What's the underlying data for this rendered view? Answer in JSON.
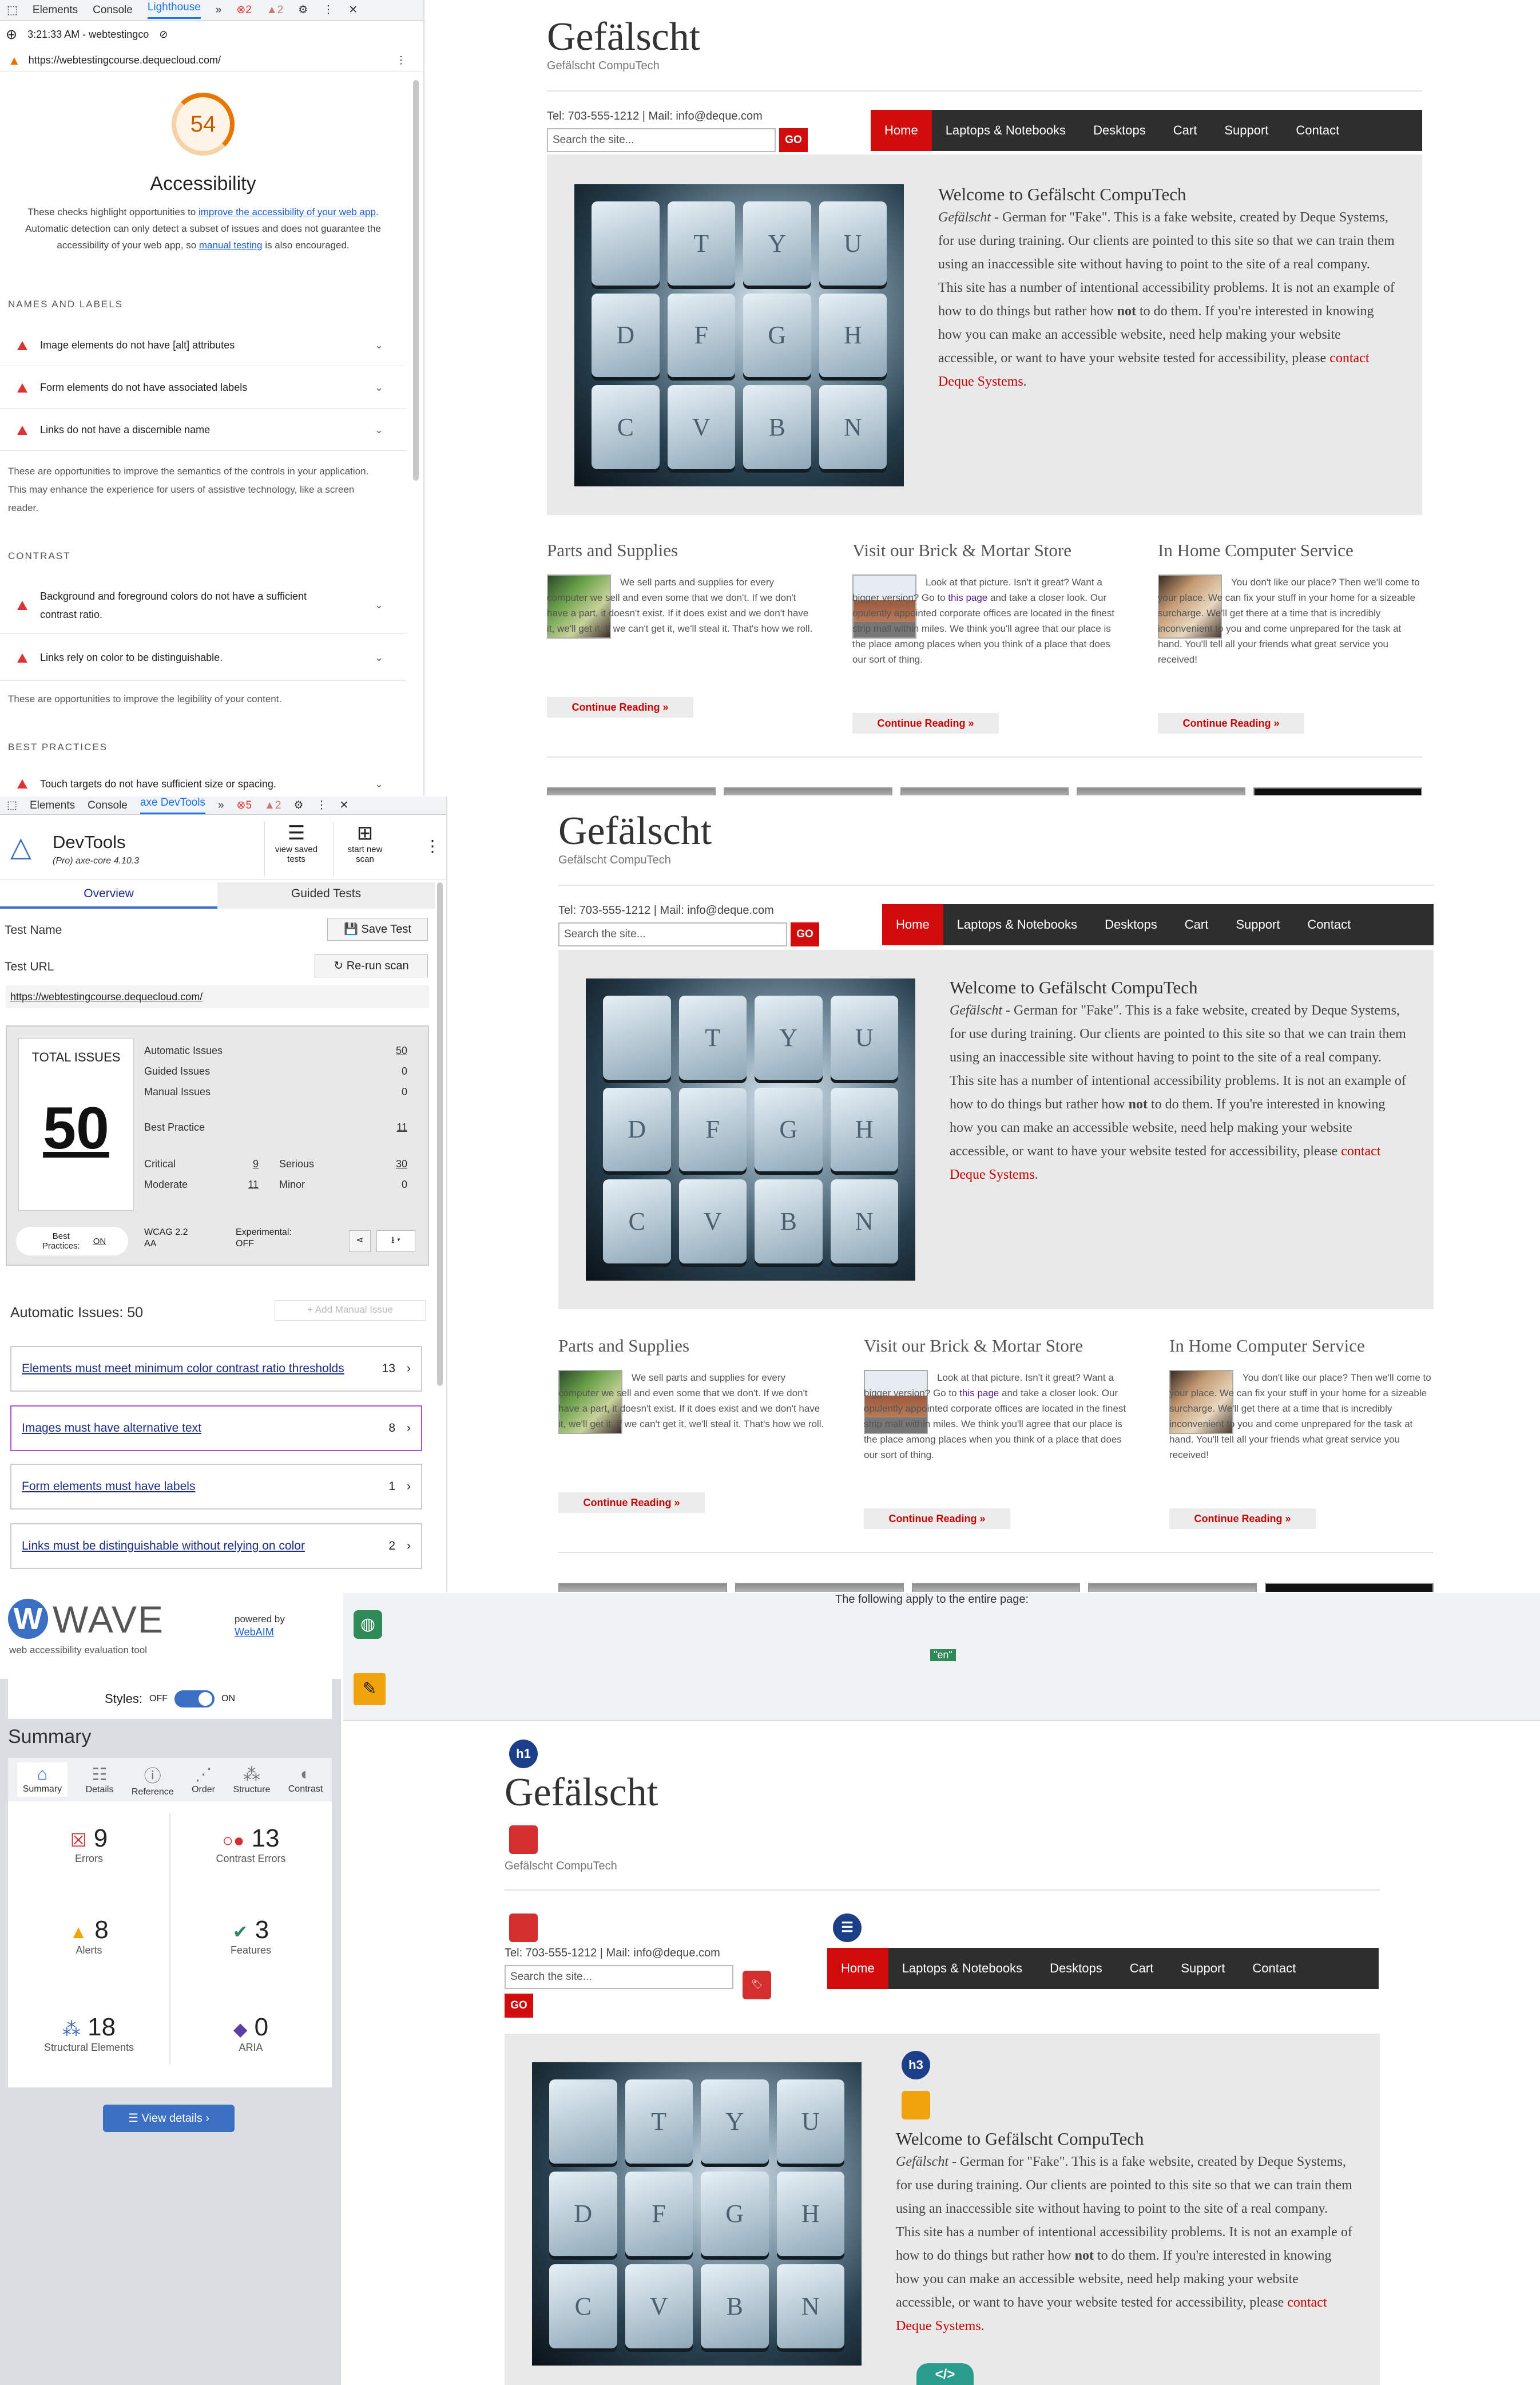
{
  "site": {
    "title": "Gefälscht",
    "tagline": "Gefälscht CompuTech",
    "contact": "Tel: 703-555-1212 | Mail: info@deque.com",
    "search_placeholder": "Search the site...",
    "go_label": "GO",
    "nav": [
      "Home",
      "Laptops & Notebooks",
      "Desktops",
      "Cart",
      "Support",
      "Contact"
    ],
    "hero_heading": "Welcome to Gefälscht CompuTech",
    "hero_intro_italic": "Gefälscht",
    "hero_intro_rest": " - German for \"Fake\". This is a fake website, created by Deque Systems, for use during training. Our clients are pointed to this site so that we can train them using an inaccessible site without having to point to the site of a real company. This site has a number of intentional accessibility problems. It is not an example of how to do things but rather how ",
    "hero_not": "not",
    "hero_rest2": " to do them. If you're interested in knowing how you can make an accessible website, need help making your website accessible, or want to have your website tested for accessibility, please ",
    "hero_link": "contact Deque Systems",
    "hero_end": ".",
    "keys": [
      "",
      "T",
      "Y",
      "U",
      "D",
      "F",
      "G",
      "H",
      "C",
      "V",
      "B",
      "N"
    ],
    "columns": [
      {
        "title": "Parts and Supplies",
        "text": "We sell parts and supplies for every computer we sell and even some that we don't. If we don't have a part, it doesn't exist. If it does exist and we don't have it, we'll get it. If we can't get it, we'll steal it. That's how we roll.",
        "link": "",
        "button": "Continue Reading »"
      },
      {
        "title": "Visit our Brick & Mortar Store",
        "text_a": "Look at that picture. Isn't it great? Want a bigger version? Go to ",
        "link": "this page",
        "text_b": " and take a closer look. Our opulently appointed corporate offices are located in the finest strip mall within miles. We think you'll agree that our place is the place among places when you think of a place that does our sort of thing.",
        "button": "Continue Reading »"
      },
      {
        "title": "In Home Computer Service",
        "text": "You don't like our place? Then we'll come to your place. We can fix your stuff in your home for a sizeable surcharge. We'll get there at a time that is incredibly inconvenient to you and come unprepared for the task at hand. You'll tell all your friends what great service you received!",
        "link": "",
        "button": "Continue Reading »"
      }
    ]
  },
  "lighthouse": {
    "tabs": [
      "Elements",
      "Console",
      "Lighthouse",
      "»"
    ],
    "error_count": "2",
    "warn_count": "2",
    "timestamp": "3:21:33 AM - webtestingco",
    "url": "https://webtestingcourse.dequecloud.com/",
    "score": "54",
    "score_color": "#e67700",
    "title": "Accessibility",
    "desc_a": "These checks highlight opportunities to ",
    "desc_link1": "improve the accessibility of your web app",
    "desc_b": ". Automatic detection can only detect a subset of issues and does not guarantee the accessibility of your web app, so ",
    "desc_link2": "manual testing",
    "desc_c": " is also encouraged.",
    "sections": [
      {
        "heading": "NAMES AND LABELS",
        "items": [
          "Image elements do not have [alt] attributes",
          "Form elements do not have associated labels",
          "Links do not have a discernible name"
        ],
        "note": "These are opportunities to improve the semantics of the controls in your application. This may enhance the experience for users of assistive technology, like a screen reader."
      },
      {
        "heading": "CONTRAST",
        "items": [
          "Background and foreground colors do not have a sufficient contrast ratio.",
          "Links rely on color to be distinguishable."
        ],
        "note": "These are opportunities to improve the legibility of your content."
      },
      {
        "heading": "BEST PRACTICES",
        "items": [
          "Touch targets do not have sufficient size or spacing."
        ],
        "note": ""
      }
    ]
  },
  "axe": {
    "tabs": [
      "Elements",
      "Console",
      "axe DevTools",
      "»"
    ],
    "error_count": "5",
    "warn_count": "2",
    "product": "DevTools",
    "edition": "(Pro) axe-core 4.10.3",
    "view_saved": "view saved tests",
    "start_new": "start new scan",
    "subtabs": [
      "Overview",
      "Guided Tests"
    ],
    "test_name_label": "Test Name",
    "save_test": "Save Test",
    "test_url_label": "Test URL",
    "rerun": "Re-run scan",
    "test_url": "https://webtestingcourse.dequecloud.com/",
    "total_label": "TOTAL ISSUES",
    "total": "50",
    "rows": [
      {
        "label": "Automatic Issues",
        "value": "50"
      },
      {
        "label": "Guided Issues",
        "value": "0"
      },
      {
        "label": "Manual Issues",
        "value": "0"
      },
      {
        "label": "Best Practice",
        "value": "11"
      }
    ],
    "severity": {
      "critical_label": "Critical",
      "critical": "9",
      "serious_label": "Serious",
      "serious": "30",
      "moderate_label": "Moderate",
      "moderate": "11",
      "minor_label": "Minor",
      "minor": "0"
    },
    "toggles": {
      "best_label": "Best Practices:",
      "best_value": "ON",
      "wcag": "WCAG 2.2 AA",
      "exp_label": "Experimental:",
      "exp_value": "OFF"
    },
    "auto_heading": "Automatic Issues: 50",
    "add_manual": "+ Add Manual Issue",
    "issues": [
      {
        "title": "Elements must meet minimum color contrast ratio thresholds",
        "count": "13"
      },
      {
        "title": "Images must have alternative text",
        "count": "8"
      },
      {
        "title": "Form elements must have labels",
        "count": "1"
      },
      {
        "title": "Links must be distinguishable without relying on color",
        "count": "2"
      }
    ]
  },
  "wave": {
    "logo": "WAVE",
    "subtitle": "web accessibility evaluation tool",
    "powered": "powered by",
    "webaim": "WebAIM",
    "styles_label": "Styles:",
    "styles_off": "OFF",
    "styles_on": "ON",
    "summary_heading": "Summary",
    "tabs": [
      "Summary",
      "Details",
      "Reference",
      "Order",
      "Structure",
      "Contrast"
    ],
    "stats": [
      {
        "value": "9",
        "label": "Errors",
        "color": "#d32f2f"
      },
      {
        "value": "13",
        "label": "Contrast Errors",
        "color": "#d32f2f"
      },
      {
        "value": "8",
        "label": "Alerts",
        "color": "#f0a30a"
      },
      {
        "value": "3",
        "label": "Features",
        "color": "#2e8b57"
      },
      {
        "value": "18",
        "label": "Structural Elements",
        "color": "#3a6fc4"
      },
      {
        "value": "0",
        "label": "ARIA",
        "color": "#5b3fa8"
      }
    ],
    "view_details": "View details ›",
    "page_note": "The following apply to the entire page:",
    "lang_badge": "\"en\"",
    "h1_badge": "h1",
    "h3_badge": "h3",
    "code_badge": "</>"
  }
}
